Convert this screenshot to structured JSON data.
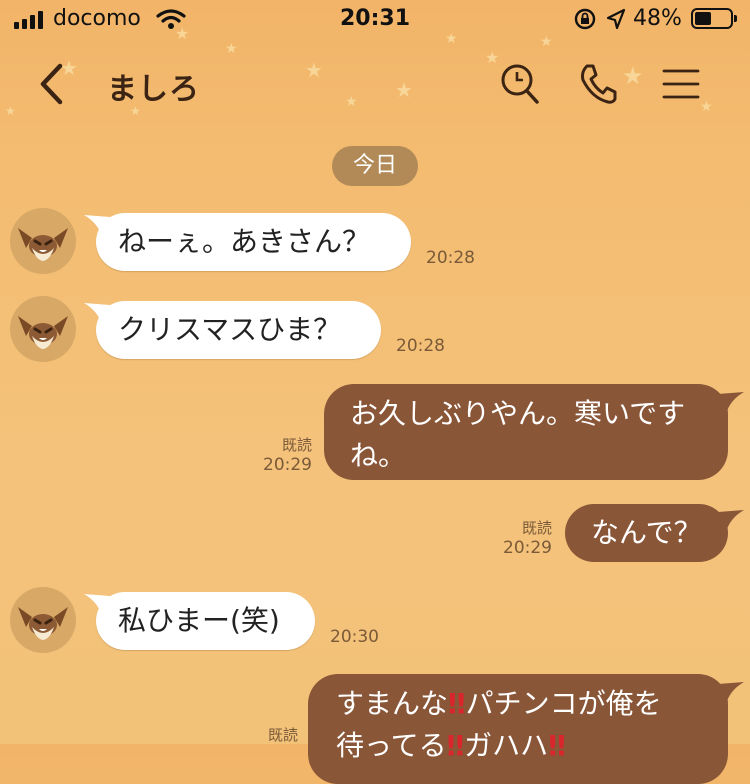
{
  "status_bar": {
    "carrier": "docomo",
    "time": "20:31",
    "battery_percent": "48%",
    "battery_level": 0.48
  },
  "header": {
    "contact_name": "ましろ",
    "icons": [
      "back-chevron-icon",
      "search-icon",
      "phone-icon",
      "menu-icon"
    ]
  },
  "date_label": "今日",
  "messages": {
    "m1": {
      "text": "ねーぇ。あきさん？",
      "time": "20:28"
    },
    "m2": {
      "text": "クリスマスひま？",
      "time": "20:28"
    },
    "m3": {
      "line1": "お久しぶりやん。寒いです",
      "line2": "ね。",
      "read": "既読",
      "time": "20:29"
    },
    "m4": {
      "text": "なんで？",
      "read": "既読",
      "time": "20:29"
    },
    "m5": {
      "text": "私ひまー(笑)",
      "time": "20:30"
    },
    "m6": {
      "part1": "すまんな",
      "excl": "‼",
      "part2": "パチンコが俺を",
      "line2a": "待ってる",
      "line2b": "ガハハ",
      "read": "既読"
    }
  },
  "colors": {
    "background": "#f3bb70",
    "outgoing_bubble": "#8a5638",
    "incoming_bubble": "#ffffff",
    "date_chip": "#b28a57",
    "exclamation": "#d8262c"
  }
}
